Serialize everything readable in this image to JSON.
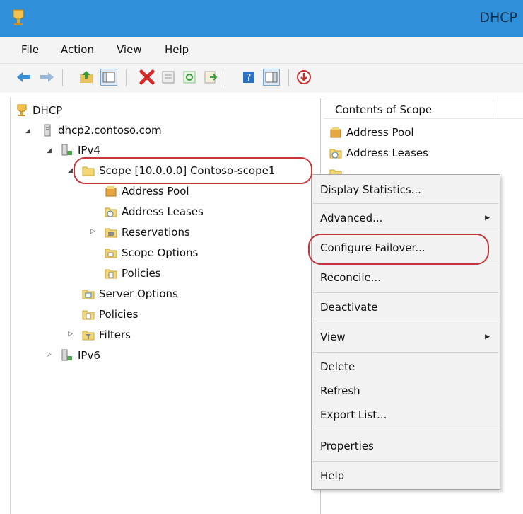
{
  "window": {
    "title": "DHCP",
    "titlebar_color": "#2f8fd8"
  },
  "menu": {
    "file": "File",
    "action": "Action",
    "view": "View",
    "help": "Help"
  },
  "toolbar": {
    "buttons": [
      "back-arrow-icon",
      "forward-arrow-icon",
      "up-folder-icon",
      "show-hide-tree-icon",
      "delete-icon",
      "properties-icon",
      "refresh-icon",
      "export-list-icon",
      "help-icon",
      "show-action-pane-icon",
      "download-icon"
    ]
  },
  "tree": {
    "root": "DHCP",
    "server": "dhcp2.contoso.com",
    "ipv4": "IPv4",
    "scope": "Scope [10.0.0.0] Contoso-scope1",
    "address_pool": "Address Pool",
    "address_leases": "Address Leases",
    "reservations": "Reservations",
    "scope_options": "Scope Options",
    "scope_policies": "Policies",
    "server_options": "Server Options",
    "policies": "Policies",
    "filters": "Filters",
    "ipv6": "IPv6"
  },
  "contents": {
    "header": "Contents of Scope",
    "items": [
      "Address Pool",
      "Address Leases"
    ]
  },
  "context_menu": {
    "display_statistics": "Display Statistics...",
    "advanced": "Advanced...",
    "configure_failover": "Configure Failover...",
    "reconcile": "Reconcile...",
    "deactivate": "Deactivate",
    "view": "View",
    "delete": "Delete",
    "refresh": "Refresh",
    "export_list": "Export List...",
    "properties": "Properties",
    "help": "Help"
  },
  "highlight_color": "#c6363b"
}
